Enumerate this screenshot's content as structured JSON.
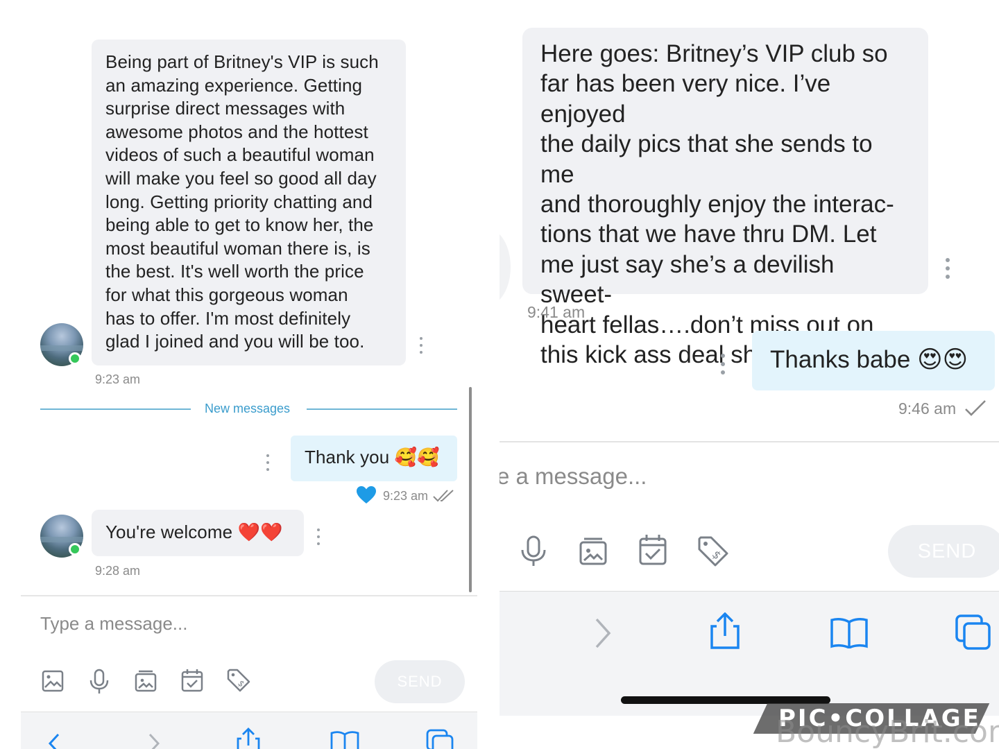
{
  "left": {
    "message1": {
      "lines": [
        "Being part of Britney's VIP is such",
        "an amazing experience. Getting",
        "surprise direct messages with",
        "awesome photos and the hottest",
        "videos of such a beautiful woman",
        "will make you feel so good all day",
        "long. Getting priority chatting and",
        "being able to get to know her, the",
        "most beautiful woman there is, is",
        "the best. It's well worth the price",
        "for what this gorgeous woman",
        "has to offer. I'm most definitely",
        "glad I joined and you will be too."
      ],
      "time": "9:23 am"
    },
    "new_messages_label": "New messages",
    "message2": {
      "text": "Thank you 🥰🥰",
      "time": "9:23 am"
    },
    "message3": {
      "text": "You're welcome ❤️❤️",
      "time": "9:28 am"
    },
    "input_placeholder": "Type a message...",
    "send_label": "SEND"
  },
  "right": {
    "message1": {
      "lines": [
        "Here goes: Britney’s VIP club so",
        "far has been very nice. I’ve enjoyed",
        "the daily pics that she sends to me",
        "and thoroughly enjoy the interac-",
        "tions that we have thru DM. Let",
        "me just say she’s a devilish sweet-",
        "heart fellas….don’t miss out on",
        "this kick ass deal she’s offering!"
      ],
      "time": "9:41 am"
    },
    "message2": {
      "text": "Thanks babe 😍😍",
      "time": "9:46 am"
    },
    "input_placeholder_partial": "e a message...",
    "send_label": "SEND"
  },
  "watermark": {
    "collage": "PIC•COLLAGE",
    "site": "BouncyBrit.com"
  },
  "colors": {
    "incoming_bubble": "#f0f1f4",
    "outgoing_bubble": "#e3f4fc",
    "accent": "#3a9ccc",
    "online": "#35c85a",
    "heart_icon": "#1e9be6",
    "ios_blue": "#1a85f0"
  }
}
